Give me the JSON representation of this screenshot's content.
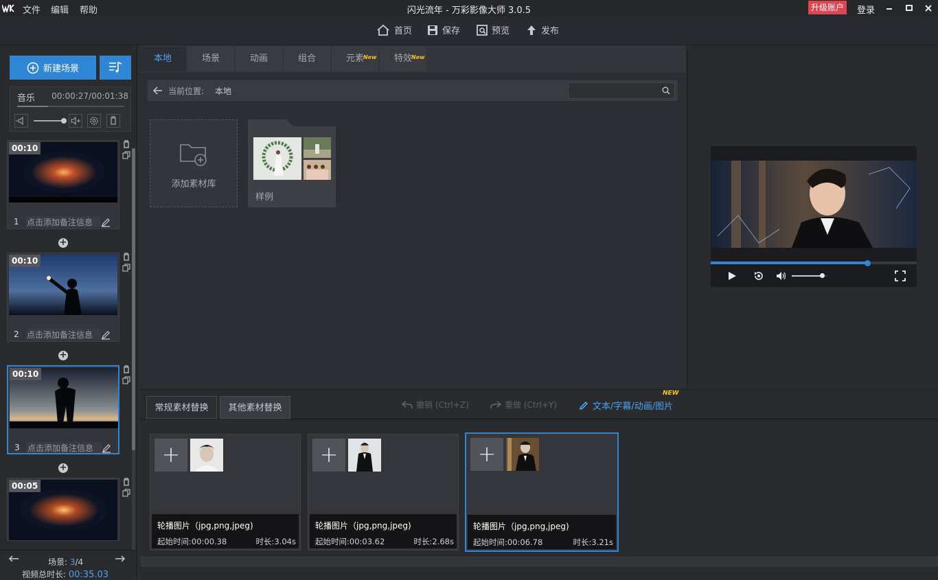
{
  "app": {
    "title": "闪光流年 - 万彩影像大师 3.0.5",
    "menu": [
      "文件",
      "编辑",
      "帮助"
    ],
    "upgrade": "升级账户",
    "login": "登录",
    "accent": "#2f86d6"
  },
  "toolbar": {
    "home": "首页",
    "save": "保存",
    "preview": "预览",
    "publish": "发布"
  },
  "left": {
    "new_scene": "新建场景",
    "music_label": "音乐",
    "music_time": "00:00:27/00:01:38",
    "scenes": [
      {
        "time": "00:10",
        "num": "1",
        "note": "点击添加备注信息"
      },
      {
        "time": "00:10",
        "num": "2",
        "note": "点击添加备注信息"
      },
      {
        "time": "00:10",
        "num": "3",
        "note": "点击添加备注信息"
      },
      {
        "time": "00:05"
      }
    ],
    "scene_label": "场景:",
    "scene_current": "3",
    "scene_total": "/4",
    "total_label": "视频总时长:",
    "total_value": "00:35.03"
  },
  "center": {
    "tabs": [
      "本地",
      "场景",
      "动画",
      "组合",
      "元素",
      "特效"
    ],
    "new_badge": "New",
    "path_label": "当前位置:",
    "path_value": "本地",
    "search_placeholder": "",
    "add_library": "添加素材库",
    "folder_name": "样例"
  },
  "bottom": {
    "tab_regular": "常规素材替换",
    "tab_other": "其他素材替换",
    "undo": "撤销 (Ctrl+Z)",
    "redo": "重做 (Ctrl+Y)",
    "text_link": "文本/字幕/动画/图片",
    "new_badge": "NEW",
    "items": [
      {
        "format": "轮播图片（jpg,png,jpeg)",
        "start": "起始时间:00:00.38",
        "duration": "时长:3.04s"
      },
      {
        "format": "轮播图片（jpg,png,jpeg)",
        "start": "起始时间:00:03.62",
        "duration": "时长:2.68s"
      },
      {
        "format": "轮播图片（jpg,png,jpeg)",
        "start": "起始时间:00:06.78",
        "duration": "时长:3.21s"
      }
    ]
  },
  "player": {
    "progress": 0.76,
    "volume": 0.85
  }
}
